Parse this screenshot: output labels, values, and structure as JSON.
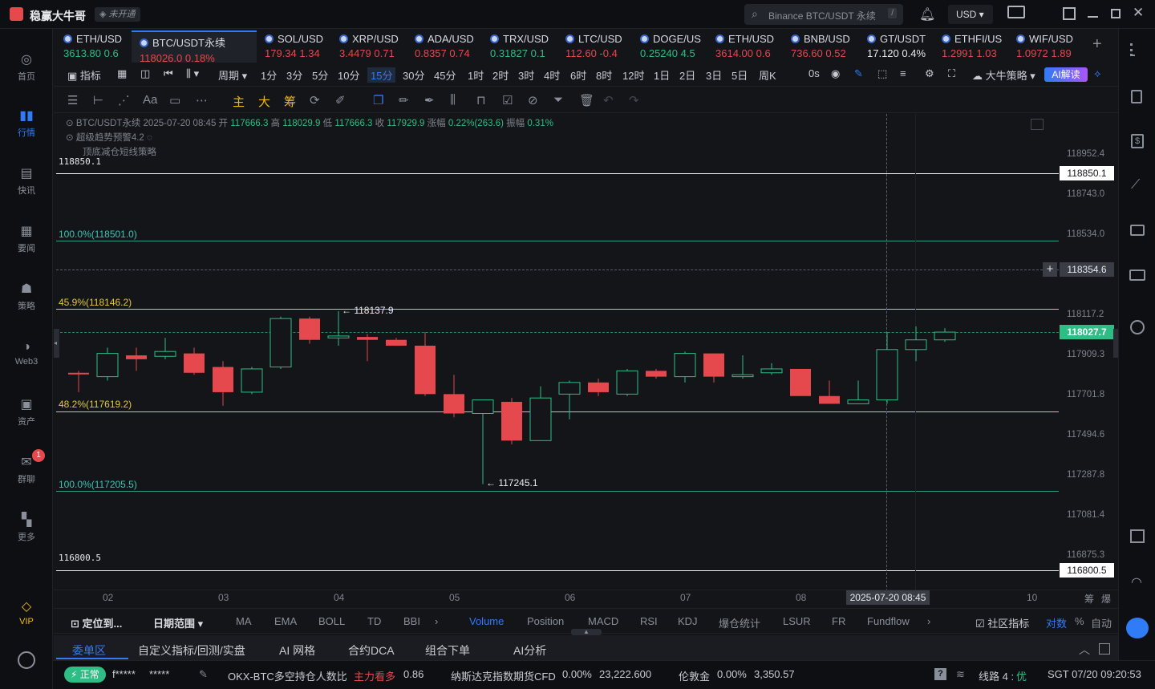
{
  "app": {
    "name": "稳赢大牛哥",
    "status": "未开通",
    "search_placeholder": "Binance BTC/USDT 永续",
    "currency": "USD"
  },
  "nav": [
    {
      "label": "首页",
      "icon": "home-icon"
    },
    {
      "label": "行情",
      "icon": "market-icon",
      "active": true
    },
    {
      "label": "快讯",
      "icon": "news-icon"
    },
    {
      "label": "要闻",
      "icon": "headline-icon"
    },
    {
      "label": "策略",
      "icon": "strategy-icon"
    },
    {
      "label": "Web3",
      "icon": "web3-icon"
    },
    {
      "label": "资产",
      "icon": "wallet-icon"
    },
    {
      "label": "群聊",
      "icon": "chat-icon",
      "badge": "1"
    },
    {
      "label": "更多",
      "icon": "more-icon"
    },
    {
      "label": "VIP",
      "icon": "vip-icon"
    }
  ],
  "tickers": [
    {
      "sym": "ETH/USD",
      "price": "3613.80",
      "chg": "0.6",
      "dir": "green"
    },
    {
      "sym": "BTC/USDT永续",
      "price": "118026.0",
      "chg": "0.18%",
      "dir": "red",
      "active": true
    },
    {
      "sym": "SOL/USD",
      "price": "179.34",
      "chg": "1.34",
      "dir": "red"
    },
    {
      "sym": "XRP/USD",
      "price": "3.4479",
      "chg": "0.71",
      "dir": "red"
    },
    {
      "sym": "ADA/USD",
      "price": "0.8357",
      "chg": "0.74",
      "dir": "red"
    },
    {
      "sym": "TRX/USD",
      "price": "0.31827",
      "chg": "0.1",
      "dir": "green"
    },
    {
      "sym": "LTC/USD",
      "price": "112.60",
      "chg": "-0.4",
      "dir": "red"
    },
    {
      "sym": "DOGE/US",
      "price": "0.25240",
      "chg": "4.5",
      "dir": "green"
    },
    {
      "sym": "ETH/USD",
      "price": "3614.00",
      "chg": "0.6",
      "dir": "red"
    },
    {
      "sym": "BNB/USD",
      "price": "736.60",
      "chg": "0.52",
      "dir": "red"
    },
    {
      "sym": "GT/USDT",
      "price": "17.120",
      "chg": "0.4%",
      "dir": "white"
    },
    {
      "sym": "ETHFI/US",
      "price": "1.2991",
      "chg": "1.03",
      "dir": "red"
    },
    {
      "sym": "WIF/USD",
      "price": "1.0972",
      "chg": "1.89",
      "dir": "red"
    }
  ],
  "toolbar": {
    "indicators": "指标",
    "period": "周期",
    "intervals": [
      "1分",
      "3分",
      "5分",
      "10分",
      "15分",
      "30分",
      "45分",
      "1时",
      "2时",
      "3时",
      "4时",
      "6时",
      "8时",
      "12时",
      "1日",
      "2日",
      "3日",
      "5日",
      "周K"
    ],
    "active_interval": "15分",
    "countdown": "0s",
    "strategy": "大牛策略",
    "ai": "AI解读"
  },
  "drawbar": {
    "main": "主",
    "big": "大",
    "chip": "筹"
  },
  "chart_header": {
    "line1": "BTC/USDT永续 2025-07-20 08:45",
    "open_label": "开",
    "open": "117666.3",
    "high_label": "高",
    "high": "118029.9",
    "low_label": "低",
    "low": "117666.3",
    "close_label": "收",
    "close": "117929.9",
    "chg_label": "涨幅",
    "chg": "0.22%(263.6)",
    "amp_label": "振幅",
    "amp": "0.31%",
    "ind1": "超级趋势预警4.2",
    "ind2": "顶底减仓短线策略"
  },
  "levels": {
    "top": "118850.1",
    "fib100a": "100.0%(118501.0)",
    "fib459": "45.9%(118146.2)",
    "fib482": "48.2%(117619.2)",
    "fib100b": "100.0%(117205.5)",
    "bottom": "116800.5",
    "high_mark": "118137.9",
    "low_mark": "117245.1"
  },
  "y_axis": [
    "118952.4",
    "118743.0",
    "118534.0",
    "118117.2",
    "117909.3",
    "117701.8",
    "117494.6",
    "117287.8",
    "117081.4",
    "116875.3"
  ],
  "price_boxes": {
    "top": "118850.1",
    "cross": "118354.6",
    "last": "118027.7",
    "bottom": "116800.5"
  },
  "x_axis": [
    "02",
    "03",
    "04",
    "05",
    "06",
    "07",
    "08",
    "10"
  ],
  "x_cursor": "2025-07-20 08:45",
  "x_right": [
    "筹",
    "爆"
  ],
  "chart_data": {
    "type": "candlestick",
    "series": [
      {
        "o": 117820,
        "h": 117830,
        "l": 117720,
        "c": 117815
      },
      {
        "o": 117800,
        "h": 117950,
        "l": 117780,
        "c": 117920
      },
      {
        "o": 117910,
        "h": 117950,
        "l": 117830,
        "c": 117890
      },
      {
        "o": 117905,
        "h": 118000,
        "l": 117890,
        "c": 117930
      },
      {
        "o": 117920,
        "h": 117950,
        "l": 117810,
        "c": 117820
      },
      {
        "o": 117850,
        "h": 117880,
        "l": 117650,
        "c": 117720
      },
      {
        "o": 117720,
        "h": 117850,
        "l": 117710,
        "c": 117840
      },
      {
        "o": 117850,
        "h": 118110,
        "l": 117840,
        "c": 118100
      },
      {
        "o": 118100,
        "h": 118110,
        "l": 117970,
        "c": 117990
      },
      {
        "o": 118000,
        "h": 118138,
        "l": 117960,
        "c": 118010
      },
      {
        "o": 118005,
        "h": 118020,
        "l": 117880,
        "c": 117990
      },
      {
        "o": 117990,
        "h": 118000,
        "l": 117960,
        "c": 117960
      },
      {
        "o": 117960,
        "h": 118030,
        "l": 117700,
        "c": 117710
      },
      {
        "o": 117710,
        "h": 117810,
        "l": 117590,
        "c": 117610
      },
      {
        "o": 117610,
        "h": 117680,
        "l": 117245,
        "c": 117680
      },
      {
        "o": 117670,
        "h": 117690,
        "l": 117450,
        "c": 117470
      },
      {
        "o": 117470,
        "h": 117750,
        "l": 117470,
        "c": 117690
      },
      {
        "o": 117710,
        "h": 117780,
        "l": 117580,
        "c": 117770
      },
      {
        "o": 117770,
        "h": 117790,
        "l": 117700,
        "c": 117720
      },
      {
        "o": 117710,
        "h": 117840,
        "l": 117700,
        "c": 117830
      },
      {
        "o": 117830,
        "h": 117840,
        "l": 117790,
        "c": 117800
      },
      {
        "o": 117800,
        "h": 117930,
        "l": 117770,
        "c": 117920
      },
      {
        "o": 117920,
        "h": 117920,
        "l": 117770,
        "c": 117800
      },
      {
        "o": 117800,
        "h": 117910,
        "l": 117790,
        "c": 117810
      },
      {
        "o": 117820,
        "h": 117870,
        "l": 117810,
        "c": 117840
      },
      {
        "o": 117840,
        "h": 117840,
        "l": 117700,
        "c": 117700
      },
      {
        "o": 117700,
        "h": 117780,
        "l": 117660,
        "c": 117660
      },
      {
        "o": 117660,
        "h": 117780,
        "l": 117660,
        "c": 117680
      },
      {
        "o": 117680,
        "h": 118030,
        "l": 117660,
        "c": 117940
      },
      {
        "o": 117940,
        "h": 118060,
        "l": 117880,
        "c": 117990
      },
      {
        "o": 117990,
        "h": 118050,
        "l": 117980,
        "c": 118030
      }
    ],
    "y_min": 116800.5,
    "y_max": 118952.4
  },
  "ind_tabs": {
    "locate": "定位到...",
    "range": "日期范围",
    "items": [
      "MA",
      "EMA",
      "BOLL",
      "TD",
      "BBI",
      "Volume",
      "Position",
      "MACD",
      "RSI",
      "KDJ",
      "爆仓统计",
      "LSUR",
      "FR",
      "Fundflow"
    ],
    "active": "Volume",
    "community": "社区指标",
    "compare": "对数",
    "pct": "%",
    "auto": "自动"
  },
  "bottom_tabs": [
    "委单区",
    "自定义指标/回测/实盘",
    "AI 网格",
    "合约DCA",
    "组合下单",
    "AI分析"
  ],
  "status": {
    "state": "正常",
    "mask1": "f*****",
    "mask2": "*****",
    "msg": "OKX-BTC多空持仓人数比",
    "msg_tag": "主力看多",
    "msg_val": "0.86",
    "idx1": "纳斯达克指数期货CFD",
    "idx1_chg": "0.00%",
    "idx1_val": "23,222.600",
    "idx2": "伦敦金",
    "idx2_chg": "0.00%",
    "idx2_val": "3,350.57",
    "line": "线路 4 :",
    "line_q": "优",
    "clock": "SGT 07/20 09:20:53"
  }
}
